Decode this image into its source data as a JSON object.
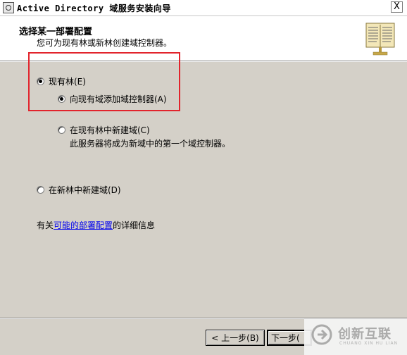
{
  "window": {
    "title": "Active Directory 域服务安装向导",
    "close_label": "X"
  },
  "header": {
    "title": "选择某一部署配置",
    "subtitle": "您可为现有林或新林创建域控制器。",
    "icon": "book-icon"
  },
  "options": {
    "existing_forest": {
      "label": "现有林(E)",
      "selected": true
    },
    "add_dc": {
      "label": "向现有域添加域控制器(A)",
      "selected": true
    },
    "new_domain": {
      "label": "在现有林中新建域(C)",
      "selected": false,
      "description": "此服务器将成为新域中的第一个域控制器。"
    },
    "new_forest": {
      "label": "在新林中新建域(D)",
      "selected": false
    }
  },
  "info": {
    "prefix": "有关",
    "link_text": "可能的部署配置",
    "suffix": "的详细信息"
  },
  "buttons": {
    "back": "< 上一步(B)",
    "next": "下一步("
  },
  "watermark": {
    "text": "创新互联",
    "sub": "CHUANG XIN HU LIAN"
  },
  "colors": {
    "highlight": "#e2242c",
    "link": "#0000ee",
    "dialog_bg": "#d4d0c8"
  }
}
